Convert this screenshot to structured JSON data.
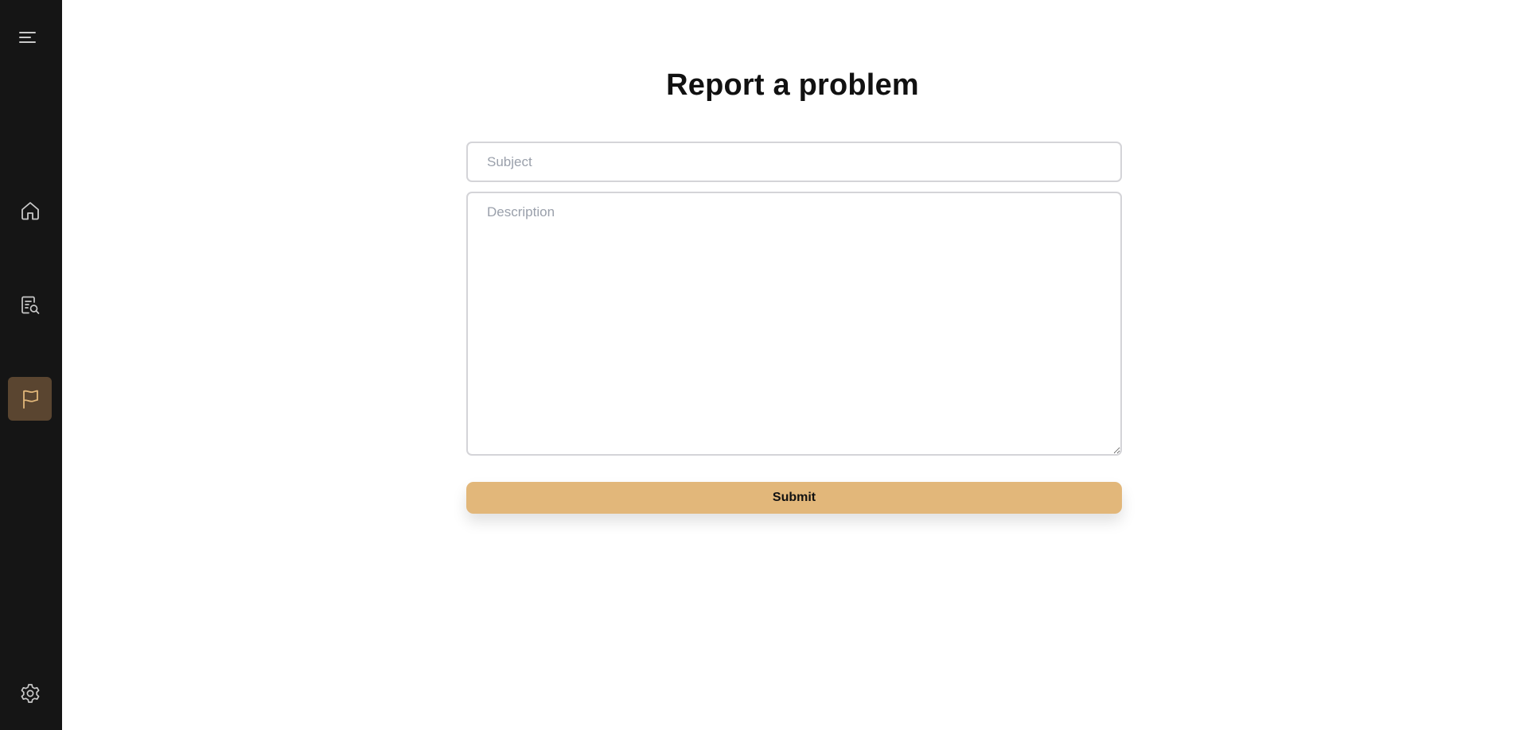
{
  "sidebar": {
    "items": [
      {
        "icon": "menu-icon"
      },
      {
        "icon": "home-icon"
      },
      {
        "icon": "document-search-icon"
      },
      {
        "icon": "flag-icon",
        "active": true
      },
      {
        "icon": "gear-icon"
      }
    ],
    "active_color": "#5a4530",
    "active_icon_color": "#e2b77a"
  },
  "main": {
    "title": "Report a problem",
    "form": {
      "subject_placeholder": "Subject",
      "subject_value": "",
      "description_placeholder": "Description",
      "description_value": "",
      "submit_label": "Submit"
    }
  },
  "colors": {
    "sidebar_bg": "#151515",
    "accent": "#e2b77a",
    "border": "#d4d4d8"
  }
}
